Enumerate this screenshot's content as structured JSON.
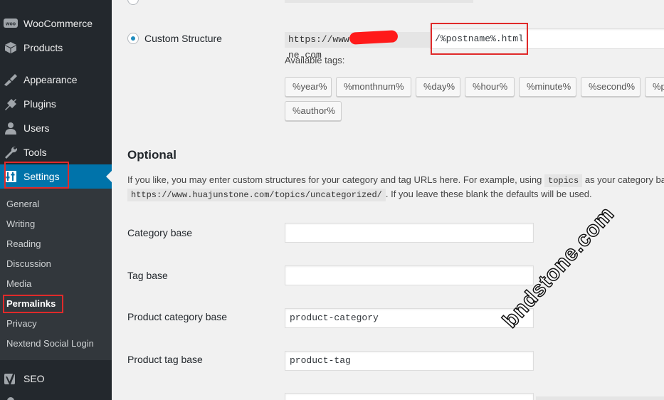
{
  "sidebar": {
    "items": [
      {
        "key": "woocommerce",
        "label": "WooCommerce",
        "icon": "woocommerce-icon"
      },
      {
        "key": "products",
        "label": "Products",
        "icon": "products-icon"
      },
      {
        "key": "appearance",
        "label": "Appearance",
        "icon": "appearance-icon"
      },
      {
        "key": "plugins",
        "label": "Plugins",
        "icon": "plugins-icon"
      },
      {
        "key": "users",
        "label": "Users",
        "icon": "users-icon"
      },
      {
        "key": "tools",
        "label": "Tools",
        "icon": "tools-icon"
      },
      {
        "key": "settings",
        "label": "Settings",
        "icon": "settings-icon"
      },
      {
        "key": "seo",
        "label": "SEO",
        "icon": "seo-icon"
      }
    ],
    "submenu": [
      "General",
      "Writing",
      "Reading",
      "Discussion",
      "Media",
      "Permalinks",
      "Privacy",
      "Nextend Social Login"
    ]
  },
  "custom_structure": {
    "label": "Custom Structure",
    "prefix": "https://www.",
    "prefix_tail": "ne.com",
    "value": "/%postname%.html",
    "available_tags_label": "Available tags:",
    "tags": [
      "%year%",
      "%monthnum%",
      "%day%",
      "%hour%",
      "%minute%",
      "%second%",
      "%p",
      "%author%"
    ]
  },
  "optional": {
    "heading": "Optional",
    "line1_pre": "If you like, you may enter custom structures for your category and tag URLs here. For example, using",
    "line1_code": "topics",
    "line1_post": "as your category bas",
    "line2_code": "https://www.huajunstone.com/topics/uncategorized/",
    "line2_post": ". If you leave these blank the defaults will be used.",
    "fields": [
      {
        "label": "Category base",
        "value": ""
      },
      {
        "label": "Tag base",
        "value": ""
      },
      {
        "label": "Product category base",
        "value": "product-category"
      },
      {
        "label": "Product tag base",
        "value": "product-tag"
      }
    ]
  },
  "watermark": "bndstone.com"
}
